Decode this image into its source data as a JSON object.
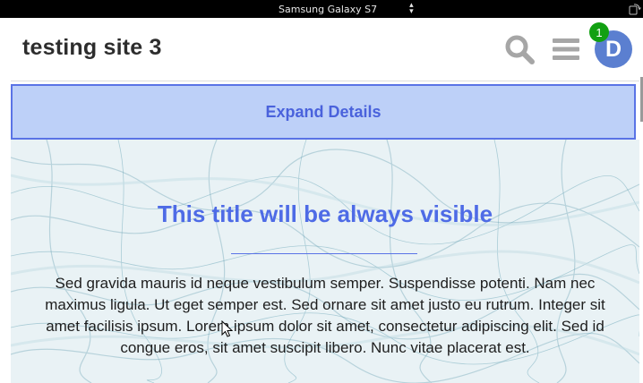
{
  "device_toolbar": {
    "device_name": "Samsung Galaxy S7",
    "rotate_icon": "rotate-device-icon"
  },
  "header": {
    "site_title": "testing site 3",
    "search_icon": "search-icon",
    "menu_icon": "hamburger-menu-icon",
    "notification_count": "1",
    "avatar_initial": "D"
  },
  "expand_details": {
    "label": "Expand Details"
  },
  "hero": {
    "title": "This title will be always visible",
    "body": "Sed gravida mauris id neque vestibulum semper. Suspendisse potenti. Nam nec maximus ligula. Ut eget semper est. Sed ornare sit amet justo eu rutrum. Integer sit amet facilisis ipsum. Lorem ipsum dolor sit amet, consectetur adipiscing elit. Sed id congue eros, sit amet suscipit libero. Nunc vitae placerat est."
  },
  "colors": {
    "accent": "#4e6be6",
    "expand_bg": "#bdd0f8",
    "badge": "#12a012",
    "avatar": "#5b7fd0"
  }
}
